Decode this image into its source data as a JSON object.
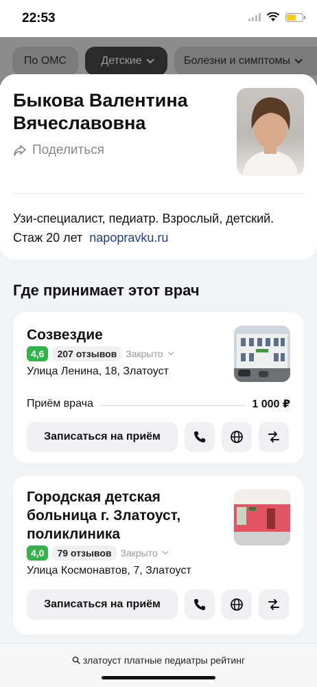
{
  "status": {
    "time": "22:53"
  },
  "chips": [
    {
      "label": "По ОМС"
    },
    {
      "label": "Детские"
    },
    {
      "label": "Болезни и симптомы"
    }
  ],
  "doctor": {
    "name": "Быкова Валентина Вячеславовна",
    "share_label": "Поделиться",
    "description": "Узи-специалист, педиатр. Взрослый, детский. Стаж 20 лет",
    "source": "napopravku.ru"
  },
  "where": {
    "title": "Где принимает этот врач"
  },
  "clinics": [
    {
      "name": "Созвездие",
      "rating": "4,6",
      "reviews": "207 отзывов",
      "status": "Закрыто",
      "address": "Улица Ленина, 18, Златоуст",
      "price_label": "Приём врача",
      "price": "1 000 ₽",
      "book_label": "Записаться на приём"
    },
    {
      "name": "Городская детская больница г. Златоуст, поликлиника",
      "rating": "4,0",
      "reviews": "79 отзывов",
      "status": "Закрыто",
      "address": "Улица Космонавтов, 7, Златоуст",
      "book_label": "Записаться на приём"
    }
  ],
  "search": {
    "query": "златоуст платные педиатры рейтинг"
  },
  "colors": {
    "rating_green": "#33b44a",
    "link_blue": "#1b3f8f"
  }
}
